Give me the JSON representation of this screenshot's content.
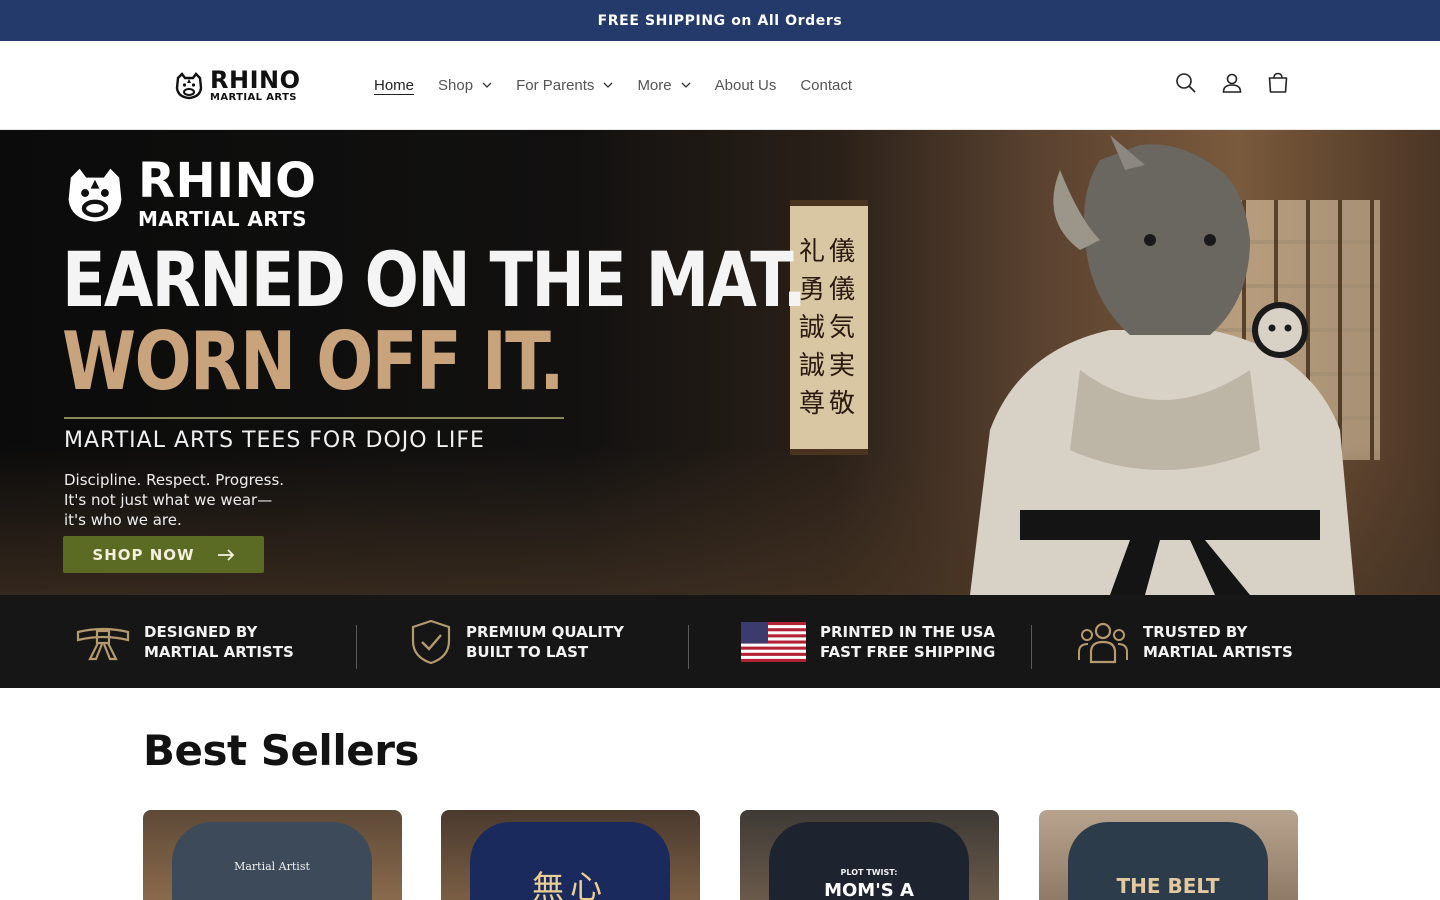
{
  "announcement": {
    "text": "FREE SHIPPING on All Orders"
  },
  "header": {
    "logo_title": "RHINO",
    "logo_subtitle": "MARTIAL ARTS",
    "nav": [
      {
        "label": "Home",
        "active": true,
        "dropdown": false
      },
      {
        "label": "Shop",
        "active": false,
        "dropdown": true
      },
      {
        "label": "For Parents",
        "active": false,
        "dropdown": true
      },
      {
        "label": "More",
        "active": false,
        "dropdown": true
      },
      {
        "label": "About Us",
        "active": false,
        "dropdown": false
      },
      {
        "label": "Contact",
        "active": false,
        "dropdown": false
      }
    ],
    "icons": [
      "search-icon",
      "account-icon",
      "cart-icon"
    ]
  },
  "hero": {
    "brand_title": "RHINO",
    "brand_subtitle": "MARTIAL ARTS",
    "headline_1": "EARNED ON THE MAT.",
    "headline_2": "WORN OFF IT.",
    "tagline": "MARTIAL ARTS TEES FOR DOJO LIFE",
    "copy_1": "Discipline. Respect. Progress.",
    "copy_2": "It's not just what we wear—",
    "copy_3": "it's who we are.",
    "cta": "SHOP NOW",
    "scroll_text": [
      "礼儀",
      "勇儀",
      "誠気",
      "誠実",
      "尊敬"
    ]
  },
  "features": [
    {
      "line1": "DESIGNED BY",
      "line2": "MARTIAL ARTISTS",
      "icon": "belt-icon"
    },
    {
      "line1": "PREMIUM QUALITY",
      "line2": "BUILT TO LAST",
      "icon": "shield-check-icon"
    },
    {
      "line1": "PRINTED IN THE USA",
      "line2": "FAST FREE SHIPPING",
      "icon": "us-flag-icon"
    },
    {
      "line1": "TRUSTED BY",
      "line2": "MARTIAL ARTISTS",
      "icon": "group-icon"
    }
  ],
  "best_sellers": {
    "title": "Best Sellers",
    "products": [
      {
        "shirt_text": "Martial Artist",
        "shirt_color": "#3c4a5a"
      },
      {
        "shirt_text": "無心",
        "shirt_color": "#1b2a5c"
      },
      {
        "shirt_text_small": "PLOT TWIST:",
        "shirt_text": "MOM'S A",
        "shirt_color": "#1d2430"
      },
      {
        "shirt_text": "THE BELT",
        "shirt_color": "#2c3c4a"
      }
    ]
  },
  "colors": {
    "announcement_bg": "#233a6b",
    "cta_bg": "#5b6b24",
    "headline_accent": "#c9a37c",
    "features_bg": "#161616"
  }
}
